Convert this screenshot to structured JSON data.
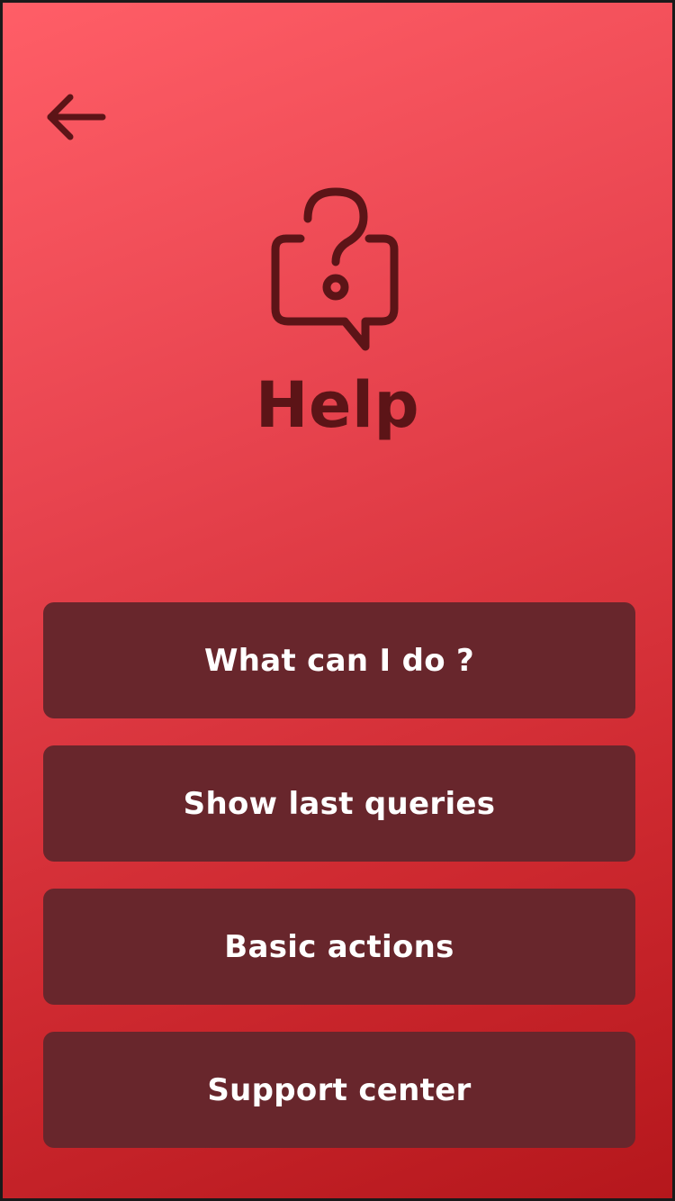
{
  "header": {
    "back_icon": "arrow-left-icon",
    "icon": "help-chat-bubble-icon",
    "title": "Help"
  },
  "colors": {
    "background_top": "#ff5e67",
    "background_bottom": "#b5171c",
    "accent_dark": "#5c1417",
    "button_bg": "#68262c",
    "button_text": "#ffffff"
  },
  "menu": {
    "items": [
      {
        "label": "What can I do ?"
      },
      {
        "label": "Show last queries"
      },
      {
        "label": "Basic actions"
      },
      {
        "label": "Support center"
      }
    ]
  }
}
